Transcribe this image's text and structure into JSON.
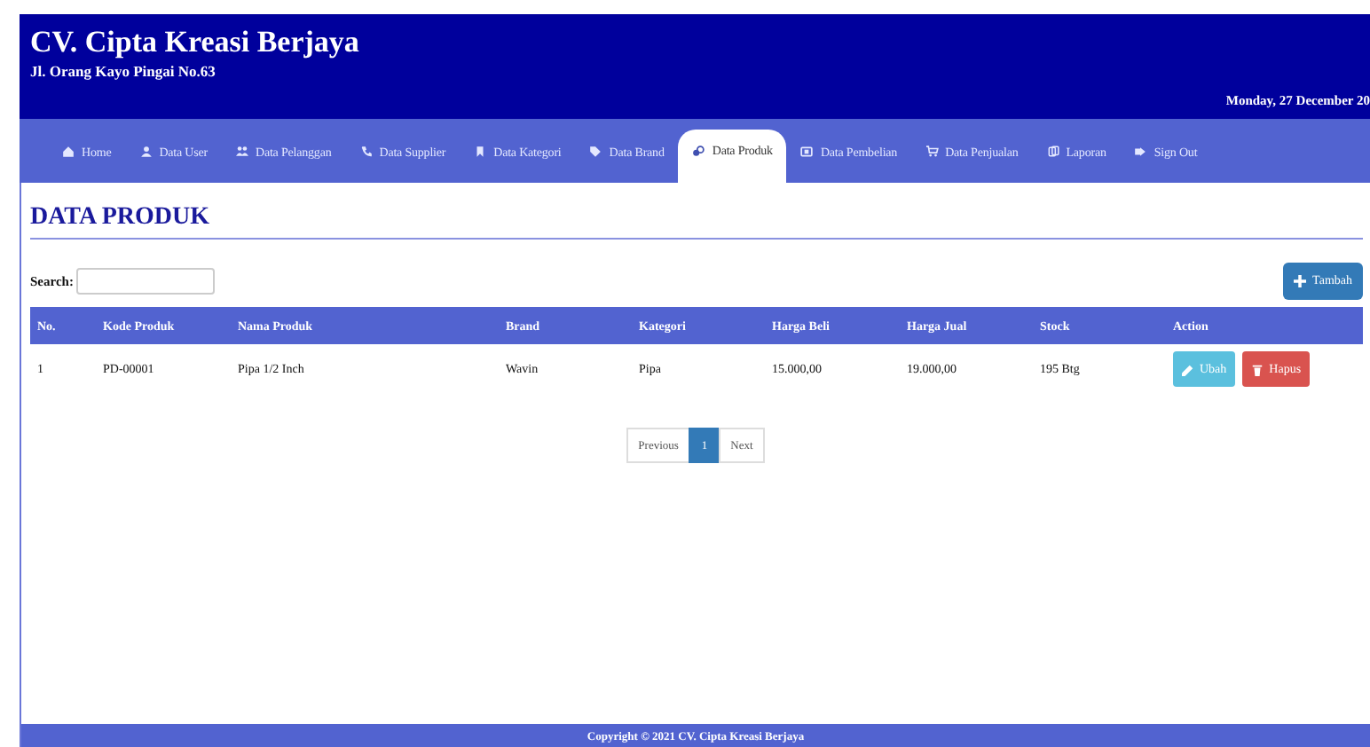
{
  "header": {
    "title": "CV. Cipta Kreasi Berjaya",
    "address": "Jl. Orang Kayo Pingai No.63",
    "date": "Monday, 27 December 20"
  },
  "nav": [
    {
      "label": "Home",
      "selected": false
    },
    {
      "label": "Data User",
      "selected": false
    },
    {
      "label": "Data Pelanggan",
      "selected": false
    },
    {
      "label": "Data Supplier",
      "selected": false
    },
    {
      "label": "Data Kategori",
      "selected": false
    },
    {
      "label": "Data Brand",
      "selected": false
    },
    {
      "label": "Data Produk",
      "selected": true
    },
    {
      "label": "Data Pembelian",
      "selected": false
    },
    {
      "label": "Data Penjualan",
      "selected": false
    },
    {
      "label": "Laporan",
      "selected": false
    },
    {
      "label": "Sign Out",
      "selected": false
    }
  ],
  "page_title": "DATA PRODUK",
  "search": {
    "label": "Search:"
  },
  "add_button": "Tambah",
  "table": {
    "columns": [
      "No.",
      "Kode Produk",
      "Nama Produk",
      "Brand",
      "Kategori",
      "Harga Beli",
      "Harga Jual",
      "Stock",
      "Action"
    ],
    "rows": [
      {
        "cells": [
          "1",
          "PD-00001",
          "Pipa 1/2 Inch",
          "Wavin",
          "Pipa",
          "15.000,00",
          "19.000,00",
          "195 Btg"
        ],
        "edit": "Ubah",
        "delete": "Hapus"
      }
    ]
  },
  "pagination": {
    "previous": "Previous",
    "pages": [
      {
        "label": "1",
        "selected": true
      }
    ],
    "next": "Next"
  },
  "footer": "Copyright © 2021 CV. Cipta Kreasi Berjaya"
}
